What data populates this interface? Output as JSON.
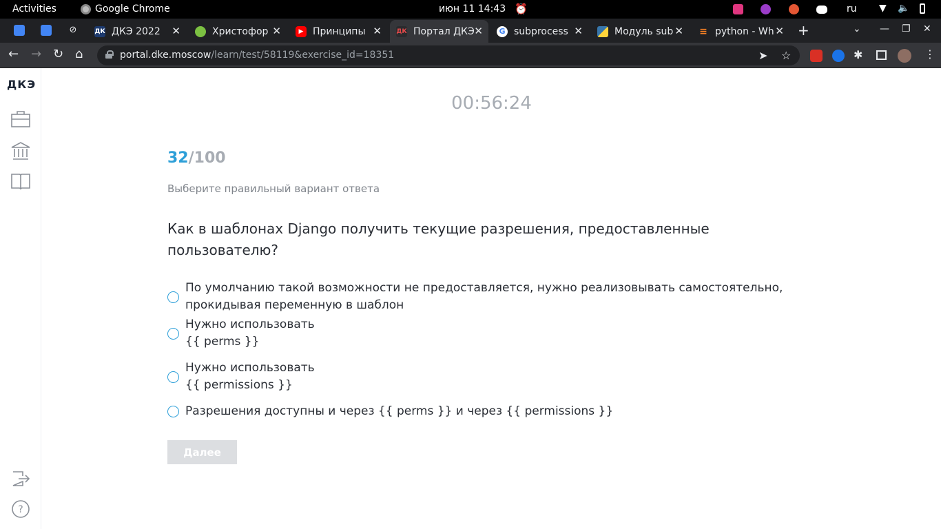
{
  "system_bar": {
    "activities": "Activities",
    "app_name": "Google Chrome",
    "clock": "июн 11  14:43",
    "language": "ru"
  },
  "tabs": [
    {
      "title": "ДКЭ 2022",
      "icon": "dke-favicon"
    },
    {
      "title": "Христофор",
      "icon": "green-circle-favicon"
    },
    {
      "title": "Принципы",
      "icon": "youtube-favicon"
    },
    {
      "title": "Портал ДКЭ",
      "icon": "dke-portal-favicon",
      "active": true
    },
    {
      "title": "subprocess",
      "icon": "google-favicon"
    },
    {
      "title": "Модуль sub",
      "icon": "python-favicon"
    },
    {
      "title": "python - Wh",
      "icon": "stackoverflow-favicon"
    }
  ],
  "address_bar": {
    "host": "portal.dke.moscow",
    "path": "/learn/test/58119&exercise_id=18351"
  },
  "sidebar": {
    "logo": "ДКЭ"
  },
  "test": {
    "timer": "00:56:24",
    "current": "32",
    "total": "/100",
    "instruction": "Выберите правильный вариант ответа",
    "question": "Как в шаблонах Django получить текущие разрешения, предоставленные пользователю?",
    "options": [
      "По умолчанию такой возможности не предоставляется, нужно реализовывать самостоятельно,\nпрокидывая переменную в шаблон",
      "Нужно использовать\n{{ perms }}",
      "Нужно использовать\n{{ permissions }}",
      "Разрешения доступны и через {{ perms }} и через {{ permissions }}"
    ],
    "next_button": "Далее"
  },
  "colors": {
    "accent": "#2d9fd8",
    "muted": "#a7acb3",
    "button_disabled": "#dcdee1"
  }
}
